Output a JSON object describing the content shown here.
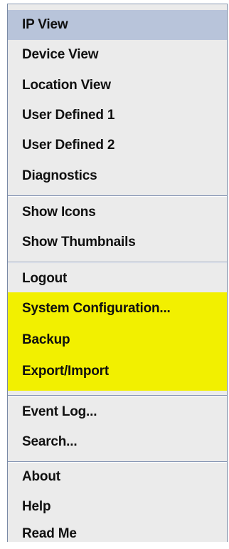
{
  "menu": {
    "group1": [
      "IP View",
      "Device View",
      "Location View",
      "User Defined 1",
      "User Defined 2",
      "Diagnostics"
    ],
    "group2": [
      "Show Icons",
      "Show Thumbnails"
    ],
    "group3": [
      "Logout",
      "System Configuration...",
      "Backup",
      "Export/Import"
    ],
    "group4": [
      "Event Log...",
      "Search..."
    ],
    "group5": [
      "About",
      "Help",
      "Read Me"
    ]
  },
  "colors": {
    "selected": "#b8c4da",
    "highlight": "#f2f000",
    "menu_bg": "#ebebeb"
  }
}
